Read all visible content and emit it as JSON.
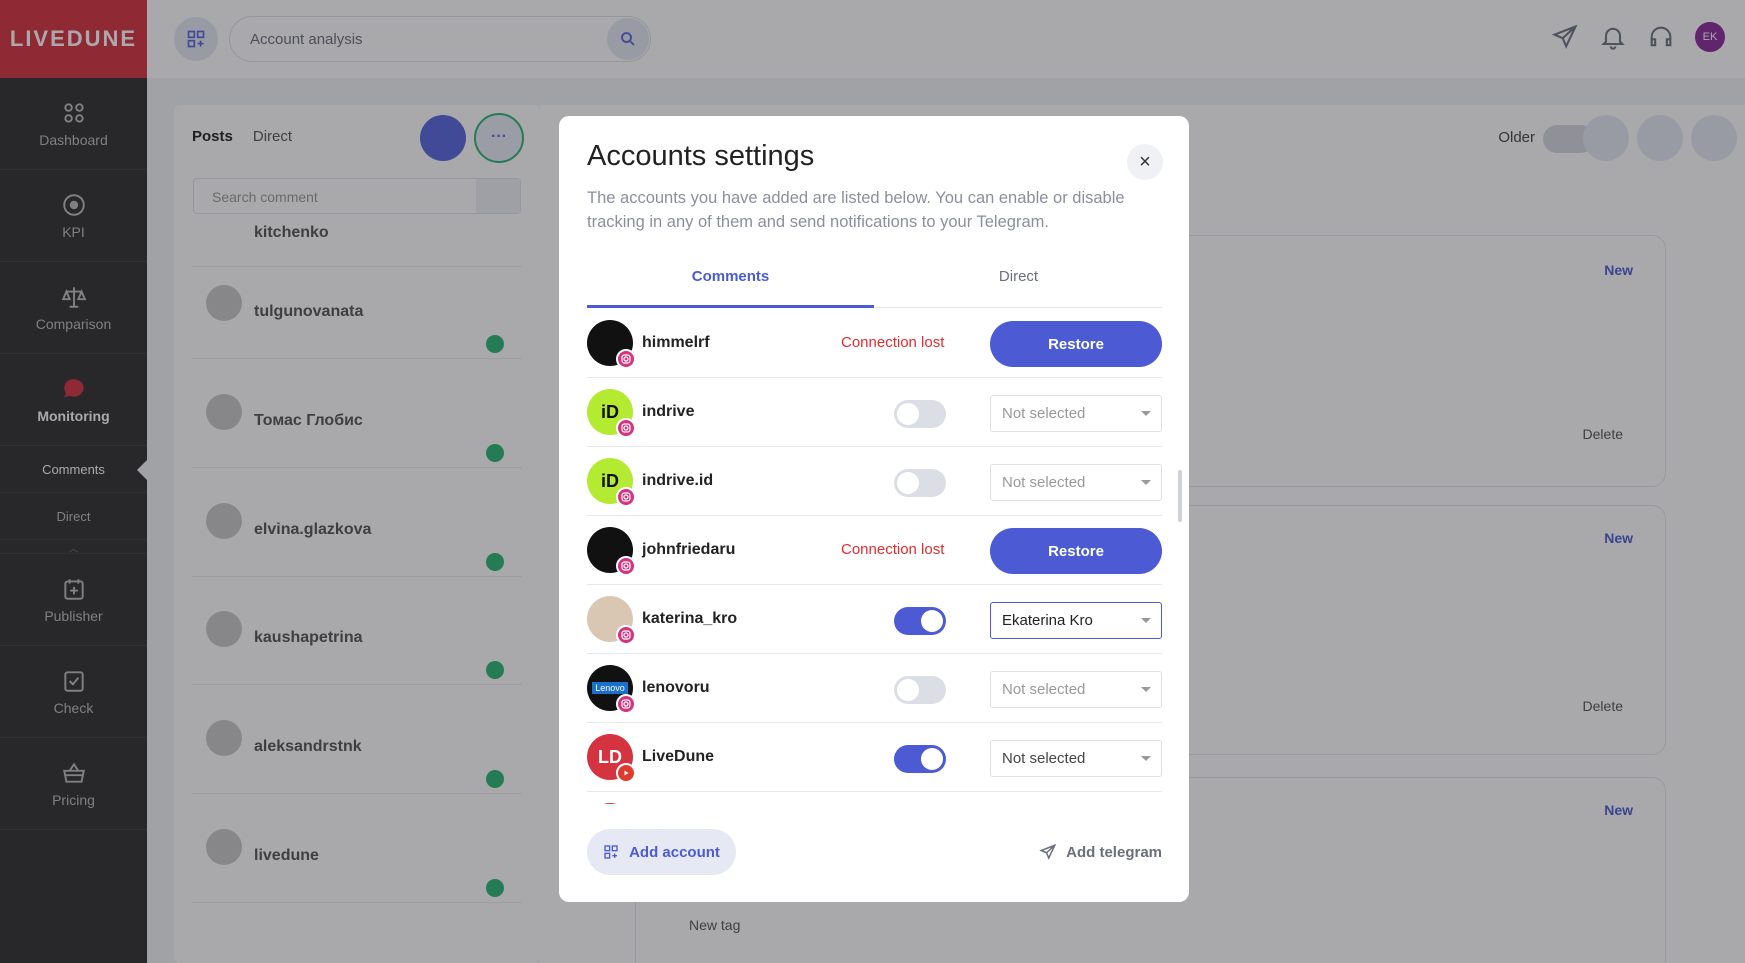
{
  "brand": {
    "logo": "LIVEDUNE",
    "accent": "#d5333f",
    "primary": "#4c5bd4"
  },
  "sidebar": {
    "items": [
      {
        "label": "Dashboard",
        "icon": "dashboard-icon"
      },
      {
        "label": "KPI",
        "icon": "target-icon"
      },
      {
        "label": "Comparison",
        "icon": "scales-icon"
      },
      {
        "label": "Monitoring",
        "icon": "chat-bubble-icon"
      }
    ],
    "sub_items": [
      "Comments",
      "Direct"
    ],
    "items_bottom": [
      {
        "label": "Publisher",
        "icon": "calendar-plus-icon"
      },
      {
        "label": "Check",
        "icon": "checkbox-icon"
      },
      {
        "label": "Pricing",
        "icon": "basket-icon"
      }
    ]
  },
  "topbar": {
    "search_value": "Account analysis",
    "avatar_initials": "EK"
  },
  "feed": {
    "tabs": [
      "Posts",
      "Direct"
    ],
    "search_placeholder": "Search comment",
    "items": [
      "kitchenko",
      "tulgunovanata",
      "Томас Глобис",
      "elvina.glazkova",
      "kaushapetrina",
      "aleksandrstnk",
      "livedune"
    ]
  },
  "right_panel": {
    "older_label": "Older",
    "new_label": "New",
    "delete_label": "Delete",
    "new_tag_label": "New tag"
  },
  "modal": {
    "title": "Accounts settings",
    "description": "The accounts you have added are listed below. You can enable or disable tracking in any of them and send notifications to your Telegram.",
    "tabs": [
      "Comments",
      "Direct"
    ],
    "accounts": [
      {
        "name": "himmelrf",
        "status": "Connection lost",
        "action": "Restore"
      },
      {
        "name": "indrive",
        "toggle": false,
        "select": "Not selected"
      },
      {
        "name": "indrive.id",
        "toggle": false,
        "select": "Not selected"
      },
      {
        "name": "johnfriedaru",
        "status": "Connection lost",
        "action": "Restore"
      },
      {
        "name": "katerina_kro",
        "toggle": true,
        "select": "Ekaterina Kro"
      },
      {
        "name": "lenovoru",
        "toggle": false,
        "select": "Not selected"
      },
      {
        "name": "LiveDune",
        "toggle": true,
        "select": "Not selected"
      }
    ],
    "add_account": "Add account",
    "add_telegram": "Add telegram"
  }
}
